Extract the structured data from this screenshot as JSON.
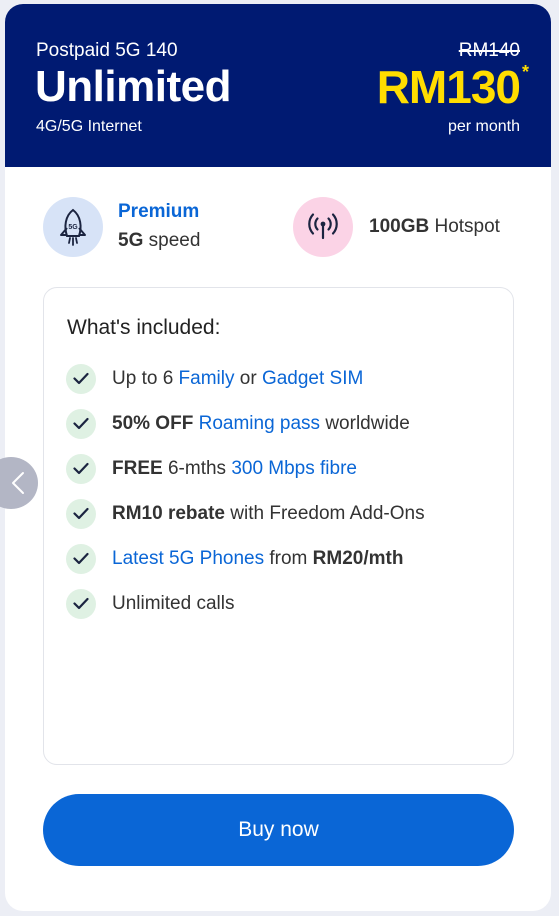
{
  "plan": {
    "subtitle": "Postpaid 5G 140",
    "name": "Unlimited",
    "network": "4G/5G Internet",
    "old_price": "RM140",
    "price": "RM130",
    "price_mark": "*",
    "period": "per month"
  },
  "features": [
    {
      "icon": "rocket-5g-icon",
      "line1": "Premium",
      "line2_bold": "5G",
      "line2_rest": " speed"
    },
    {
      "icon": "hotspot-antenna-icon",
      "bold": "100GB",
      "rest": " Hotspot"
    }
  ],
  "included": {
    "title": "What's included:",
    "items": [
      {
        "p1": "Up to 6 ",
        "l1": "Family",
        "p2": " or ",
        "l2": "Gadget SIM"
      },
      {
        "b1": "50% OFF",
        "p1": " ",
        "l1": "Roaming pass",
        "p2": " worldwide"
      },
      {
        "b1": "FREE",
        "p1": " 6-mths ",
        "l1": "300 Mbps fibre"
      },
      {
        "b1": "RM10 rebate",
        "p1": " with Freedom Add-Ons"
      },
      {
        "l1": "Latest 5G Phones",
        "p1": " from ",
        "b1": "RM20/mth"
      },
      {
        "p1": "Unlimited calls"
      }
    ]
  },
  "buy_label": "Buy now",
  "colors": {
    "header_bg": "#001a72",
    "price": "#ffdd00",
    "accent": "#0a66d6",
    "check_bg": "#dff1e3"
  }
}
